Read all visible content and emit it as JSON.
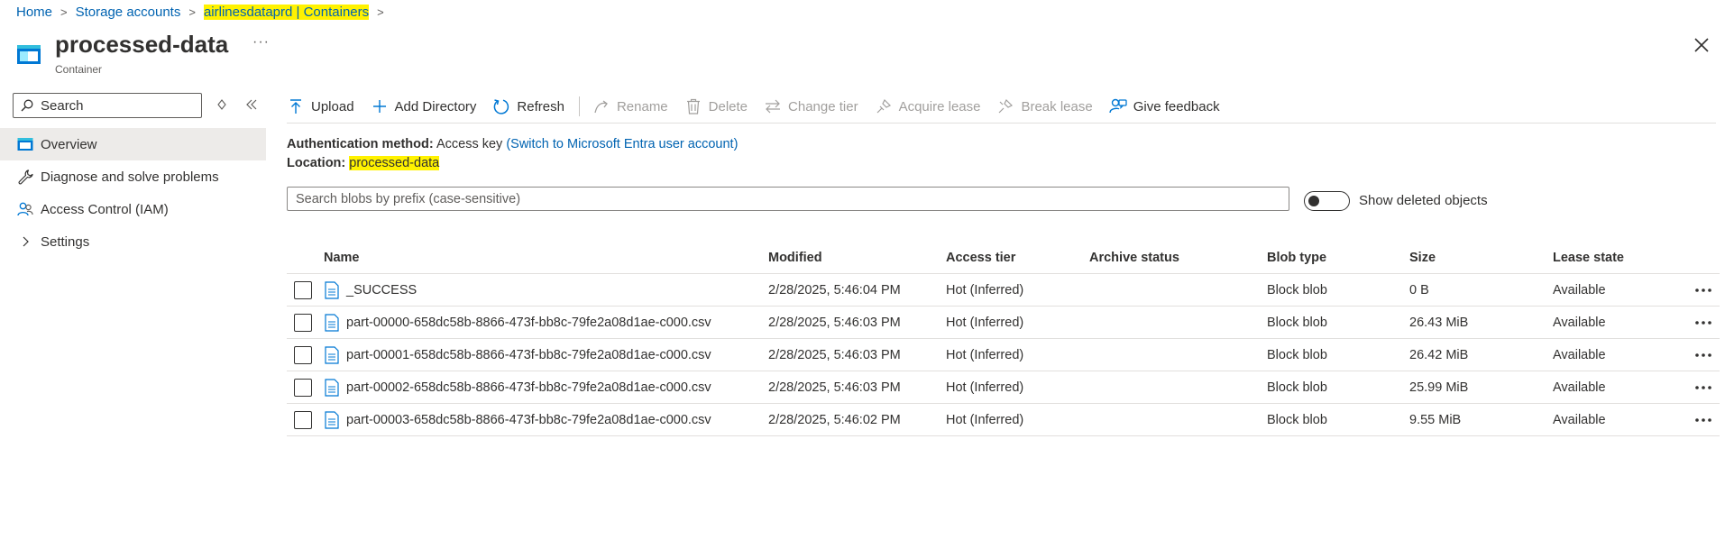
{
  "breadcrumb": {
    "items": [
      "Home",
      "Storage accounts",
      "airlinesdataprd | Containers"
    ]
  },
  "header": {
    "title": "processed-data",
    "subtitle": "Container",
    "more": "···"
  },
  "sidebar": {
    "search_placeholder": "Search",
    "items": [
      {
        "label": "Overview",
        "icon": "container-icon",
        "active": true
      },
      {
        "label": "Diagnose and solve problems",
        "icon": "wrench-icon",
        "active": false
      },
      {
        "label": "Access Control (IAM)",
        "icon": "people-icon",
        "active": false
      },
      {
        "label": "Settings",
        "icon": "chevron-right-icon",
        "active": false
      }
    ]
  },
  "toolbar": {
    "upload": "Upload",
    "add_directory": "Add Directory",
    "refresh": "Refresh",
    "rename": "Rename",
    "delete": "Delete",
    "change_tier": "Change tier",
    "acquire_lease": "Acquire lease",
    "break_lease": "Break lease",
    "give_feedback": "Give feedback"
  },
  "info": {
    "auth_label": "Authentication method:",
    "auth_value": "Access key",
    "auth_link": "(Switch to Microsoft Entra user account)",
    "location_label": "Location:",
    "location_value": "processed-data"
  },
  "blob_search": {
    "placeholder": "Search blobs by prefix (case-sensitive)"
  },
  "show_deleted": {
    "label": "Show deleted objects",
    "on": false
  },
  "table": {
    "columns": [
      "Name",
      "Modified",
      "Access tier",
      "Archive status",
      "Blob type",
      "Size",
      "Lease state"
    ],
    "rows": [
      {
        "name": "_SUCCESS",
        "modified": "2/28/2025, 5:46:04 PM",
        "tier": "Hot (Inferred)",
        "archive": "",
        "type": "Block blob",
        "size": "0 B",
        "lease": "Available"
      },
      {
        "name": "part-00000-658dc58b-8866-473f-bb8c-79fe2a08d1ae-c000.csv",
        "modified": "2/28/2025, 5:46:03 PM",
        "tier": "Hot (Inferred)",
        "archive": "",
        "type": "Block blob",
        "size": "26.43 MiB",
        "lease": "Available"
      },
      {
        "name": "part-00001-658dc58b-8866-473f-bb8c-79fe2a08d1ae-c000.csv",
        "modified": "2/28/2025, 5:46:03 PM",
        "tier": "Hot (Inferred)",
        "archive": "",
        "type": "Block blob",
        "size": "26.42 MiB",
        "lease": "Available"
      },
      {
        "name": "part-00002-658dc58b-8866-473f-bb8c-79fe2a08d1ae-c000.csv",
        "modified": "2/28/2025, 5:46:03 PM",
        "tier": "Hot (Inferred)",
        "archive": "",
        "type": "Block blob",
        "size": "25.99 MiB",
        "lease": "Available"
      },
      {
        "name": "part-00003-658dc58b-8866-473f-bb8c-79fe2a08d1ae-c000.csv",
        "modified": "2/28/2025, 5:46:02 PM",
        "tier": "Hot (Inferred)",
        "archive": "",
        "type": "Block blob",
        "size": "9.55 MiB",
        "lease": "Available"
      }
    ]
  },
  "colors": {
    "link": "#0063b1",
    "highlight": "#fff200",
    "azure_blue": "#0078d4",
    "disabled": "#a19f9d"
  }
}
